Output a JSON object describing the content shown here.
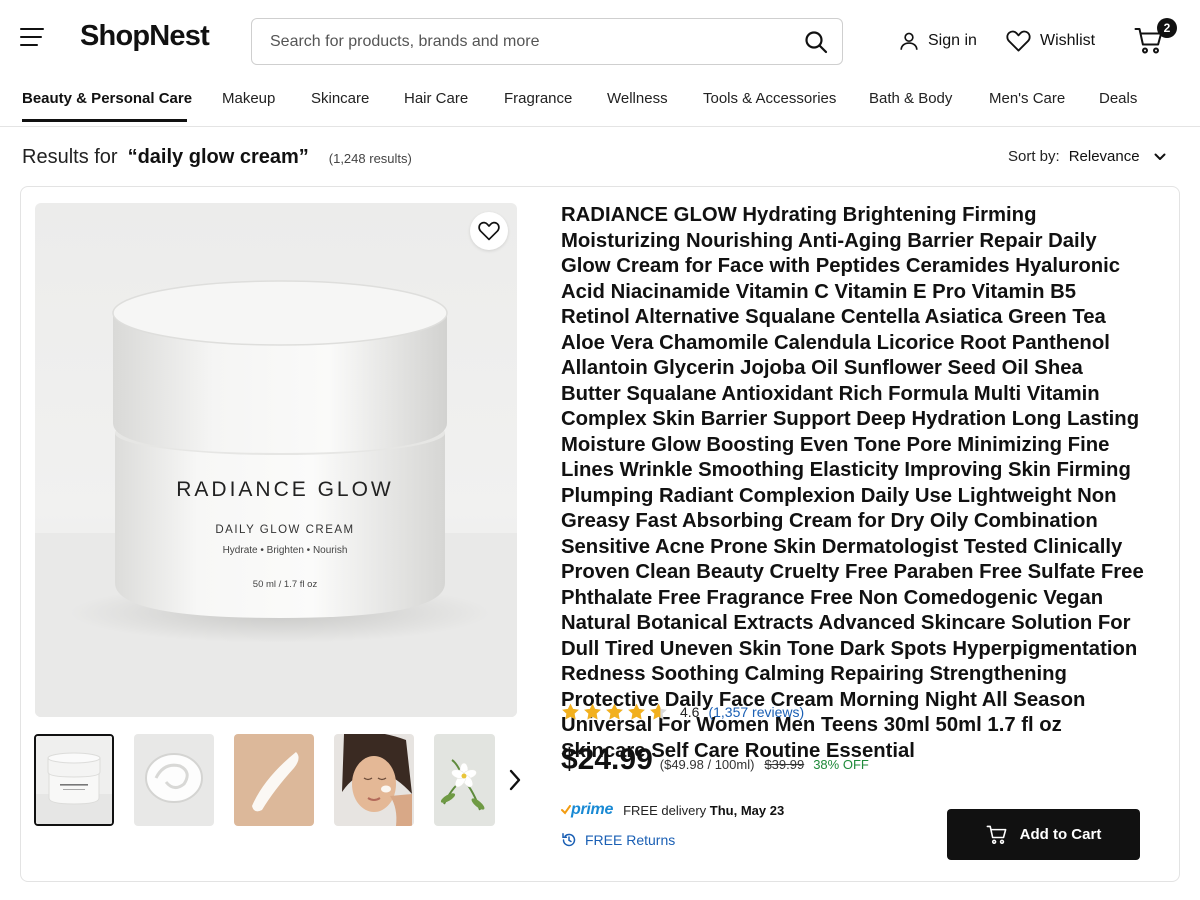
{
  "header": {
    "logo": "ShopNest",
    "search_placeholder": "Search for products, brands and more",
    "sign_in": "Sign in",
    "wishlist": "Wishlist",
    "cart_count": "2"
  },
  "categories": [
    {
      "label": "Beauty & Personal Care",
      "active": true
    },
    {
      "label": "Makeup"
    },
    {
      "label": "Skincare"
    },
    {
      "label": "Hair Care"
    },
    {
      "label": "Fragrance"
    },
    {
      "label": "Wellness"
    },
    {
      "label": "Tools & Accessories"
    },
    {
      "label": "Bath & Body"
    },
    {
      "label": "Men's Care"
    },
    {
      "label": "Deals"
    }
  ],
  "results": {
    "prefix": "Results for",
    "query": "“daily glow cream”",
    "count": "(1,248 results)",
    "sort_label": "Sort by:",
    "sort_value": "Relevance"
  },
  "product": {
    "image": {
      "brand": "RADIANCE GLOW",
      "name": "DAILY GLOW CREAM",
      "benefits": "Hydrate • Brighten • Nourish",
      "size": "50 ml / 1.7 fl oz"
    },
    "title": "RADIANCE GLOW Hydrating Brightening Firming Moisturizing Nourishing Anti-Aging Barrier Repair Daily Glow Cream for Face with Peptides Ceramides Hyaluronic Acid Niacinamide Vitamin C Vitamin E Pro Vitamin B5 Retinol Alternative Squalane Centella Asiatica Green Tea Aloe Vera Chamomile Calendula Licorice Root Panthenol Allantoin Glycerin Jojoba Oil Sunflower Seed Oil Shea Butter Squalane Antioxidant Rich Formula Multi Vitamin Complex Skin Barrier Support Deep Hydration Long Lasting Moisture Glow Boosting Even Tone Pore Minimizing Fine Lines Wrinkle Smoothing Elasticity Improving Skin Firming Plumping Radiant Complexion Daily Use Lightweight Non Greasy Fast Absorbing Cream for Dry Oily Combination Sensitive Acne Prone Skin Dermatologist Tested Clinically Proven Clean Beauty Cruelty Free Paraben Free Sulfate Free Phthalate Free Fragrance Free Non Comedogenic Vegan Natural Botanical Extracts Advanced Skincare Solution For Dull Tired Uneven Skin Tone Dark Spots Hyperpigmentation Redness Soothing Calming Repairing Strengthening Protective Daily Face Cream Morning Night All Season Universal For Women Men Teens 30ml 50ml 1.7 fl oz Skincare Self Care Routine Essential",
    "rating": 4.6,
    "rating_text": "4.6",
    "reviews": "(1,357 reviews)",
    "price": "$24.99",
    "unit_price": "($49.98 / 100ml)",
    "list_price": "$39.99",
    "discount": "38% OFF",
    "prime": "prime",
    "delivery_prefix": "FREE delivery",
    "delivery_date": "Thu, May 23",
    "returns": "FREE Returns",
    "add_to_cart": "Add to Cart"
  },
  "colors": {
    "accent": "#111111",
    "star": "#f2b01e",
    "link": "#1a5fb4",
    "discount": "#1f8a3a",
    "prime": "#1a8ad4"
  }
}
